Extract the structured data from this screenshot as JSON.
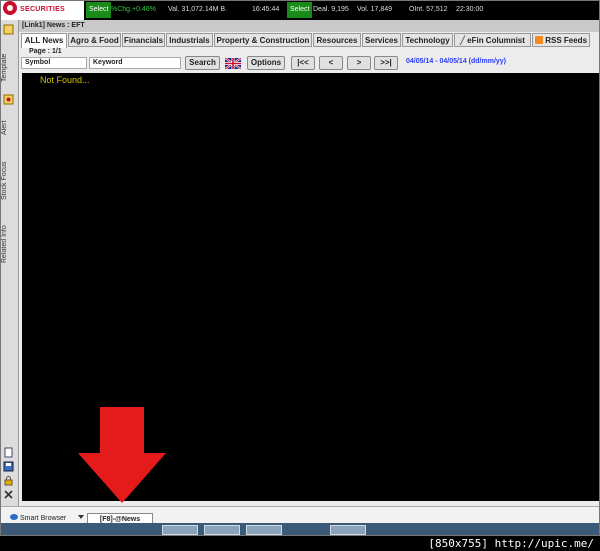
{
  "ticker": {
    "logo_text": "SECURITIES",
    "select1": "Select",
    "change": "%Chg.+0.46%",
    "value": "Val. 31,072.14M B.",
    "time": "16:45:44",
    "select2": "Select",
    "deal": "Deal. 9,195",
    "vol": "Vol. 17,849",
    "oint": "OInt. 57,512",
    "time2": "22:30:00"
  },
  "left_strip": {
    "labels": [
      "Template",
      "Alert",
      "Stock Focus",
      "Related Info"
    ]
  },
  "window": {
    "title": "[Link1] News : EFT"
  },
  "tabs": [
    {
      "label": "ALL News"
    },
    {
      "label": "Agro & Food"
    },
    {
      "label": "Financials"
    },
    {
      "label": "Industrials"
    },
    {
      "label": "Property & Construction"
    },
    {
      "label": "Resources"
    },
    {
      "label": "Services"
    },
    {
      "label": "Technology"
    },
    {
      "label": "eFin Columnist"
    },
    {
      "label": "RSS Feeds"
    }
  ],
  "page_info": "Page : 1/1",
  "toolbar": {
    "symbol_label": "Symbol",
    "keyword_label": "Keyword",
    "search": "Search",
    "options": "Options",
    "first": "|<<",
    "prev": "<",
    "next": ">",
    "last": ">>|",
    "date_range": "04/05/14 - 04/05/14 (dd/mm/yy)"
  },
  "content": {
    "message": "Not Found..."
  },
  "bottom": {
    "smart_browser": "Smart Browser",
    "f8_tab": "[F8]-@News"
  },
  "credit": "[850x755] http://upic.me/",
  "colors": {
    "accent_red": "#e51a1a",
    "link_blue": "#2a3cff",
    "notfound_yellow": "#d4c200",
    "ticker_green": "#1a8a1a"
  }
}
